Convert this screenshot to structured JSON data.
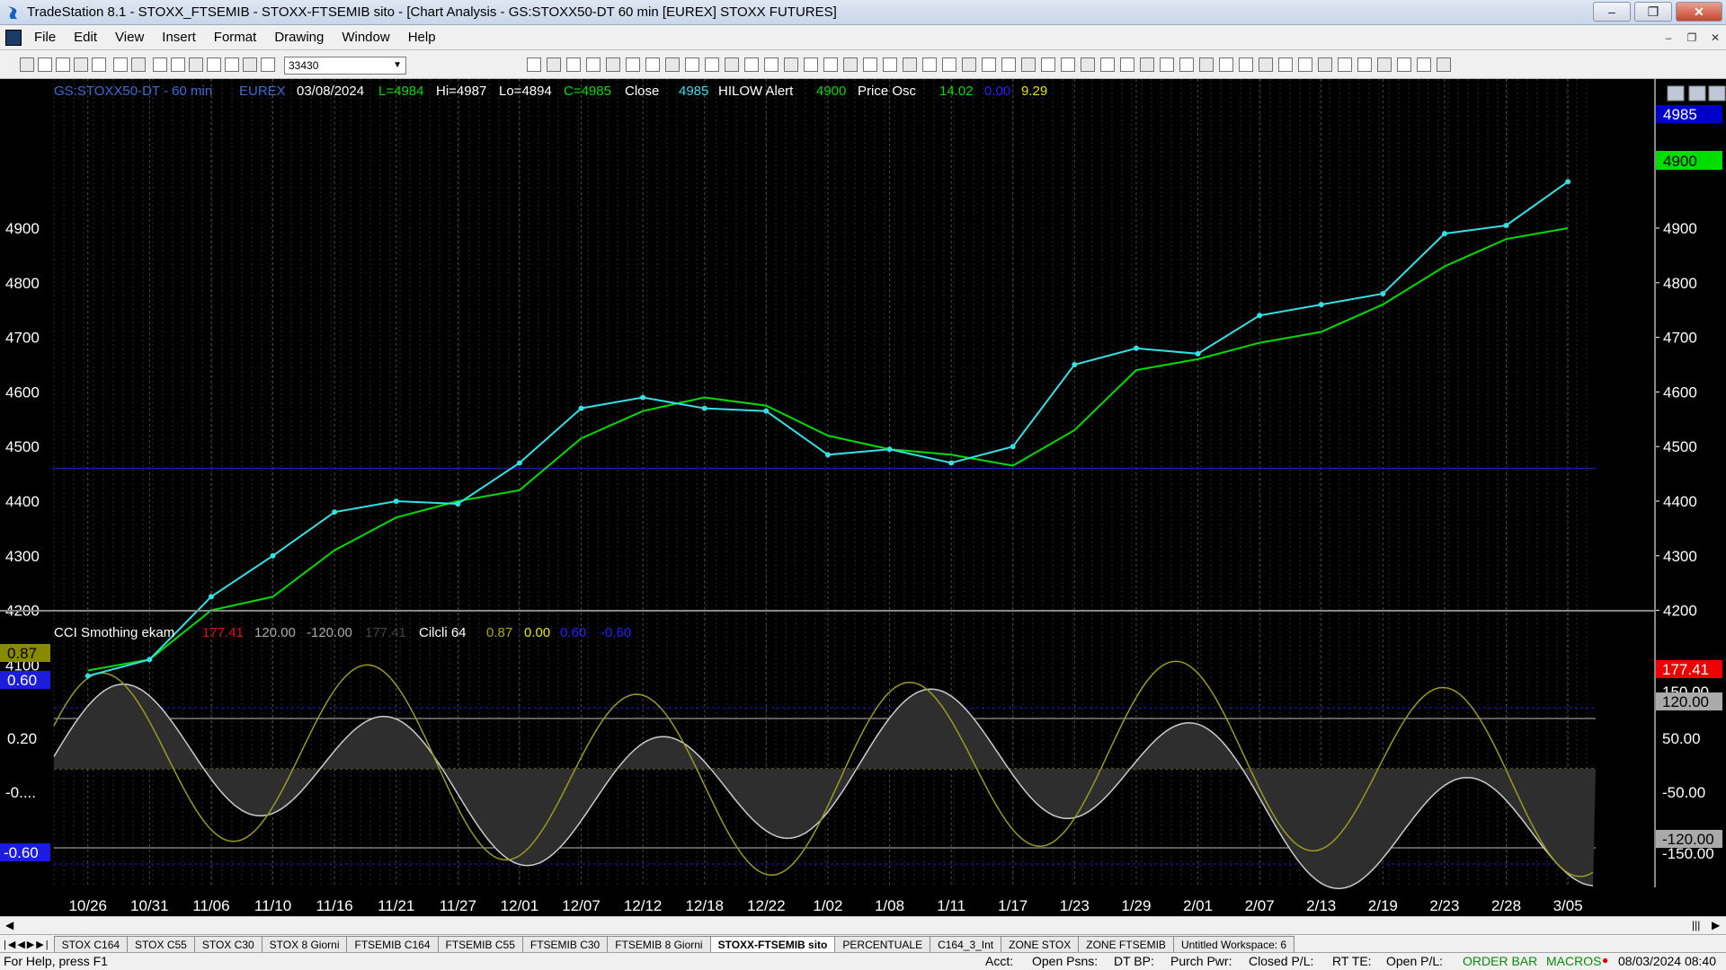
{
  "window": {
    "title": "TradeStation 8.1 - STOXX_FTSEMIB - STOXX-FTSEMIB sito - [Chart Analysis - GS:STOXX50-DT  60 min  [EUREX] STOXX FUTURES]",
    "minimize": "–",
    "restore": "❐",
    "close": "✕"
  },
  "menu": [
    "File",
    "Edit",
    "View",
    "Insert",
    "Format",
    "Drawing",
    "Window",
    "Help"
  ],
  "toolbar": {
    "symbol_value": "33430"
  },
  "chart_header": {
    "symbol": "GS:STOXX50-DT - 60 min",
    "exchange": "EUREX",
    "date": "03/08/2024",
    "last": "L=4984",
    "hi": "Hi=4987",
    "lo": "Lo=4894",
    "close_val": "C=4985",
    "close_label": "Close",
    "close_price": "4985",
    "ind1": "HILOW Alert",
    "ind1_val": "4900",
    "ind2": "Price Osc",
    "ind2_v1": "14.02",
    "ind2_v2": "0.00",
    "ind2_v3": "9.29"
  },
  "sub_header": {
    "ind1": "CCI Smothing ekam",
    "v1": "177.41",
    "v2": "120.00",
    "v3": "-120.00",
    "v4": "177.41",
    "ind2": "Cilcli 64",
    "c1": "0.87",
    "c2": "0.00",
    "c3": "0.60",
    "c4": "-0.60"
  },
  "price_axis": {
    "ticks": [
      "4900",
      "4800",
      "4700",
      "4600",
      "4500",
      "4400",
      "4300",
      "4200",
      "4100"
    ],
    "last_badge": "4985",
    "hilow_badge": "4900"
  },
  "osc_axis": {
    "right_ticks": [
      "150.00",
      "120.00",
      "50.00",
      "-50.00",
      "-120.00",
      "-150.00"
    ],
    "right_badge": "177.41",
    "left_ticks": [
      "0.20",
      "-0...."
    ],
    "left_badge_top": "0.87",
    "left_badge_mid": "0.60",
    "left_badge_bot": "-0.60"
  },
  "chart_data": {
    "type": "line",
    "x": [
      "10/26",
      "10/31",
      "11/06",
      "11/10",
      "11/16",
      "11/21",
      "11/27",
      "12/01",
      "12/07",
      "12/12",
      "12/18",
      "12/22",
      "1/02",
      "1/08",
      "1/11",
      "1/17",
      "1/23",
      "1/29",
      "2/01",
      "2/07",
      "2/13",
      "2/19",
      "2/23",
      "2/28",
      "3/05"
    ],
    "ylim": [
      4050,
      5000
    ],
    "hline": 4460,
    "series": [
      {
        "name": "Close",
        "color": "#33e0e6",
        "values": [
          4080,
          4110,
          4225,
          4300,
          4380,
          4400,
          4395,
          4470,
          4570,
          4590,
          4570,
          4565,
          4485,
          4495,
          4470,
          4500,
          4650,
          4680,
          4670,
          4740,
          4760,
          4780,
          4890,
          4905,
          4985
        ]
      },
      {
        "name": "HILOW Alert",
        "color": "#00dd00",
        "values": [
          4090,
          4110,
          4200,
          4225,
          4310,
          4370,
          4400,
          4420,
          4515,
          4565,
          4590,
          4575,
          4520,
          4495,
          4485,
          4465,
          4530,
          4640,
          4660,
          4690,
          4710,
          4760,
          4830,
          4880,
          4900
        ]
      }
    ]
  },
  "tabs": [
    "STOX C164",
    "STOX C55",
    "STOX  C30",
    "STOX  8 Giorni",
    "FTSEMIB C164",
    "FTSEMIB C55",
    "FTSEMIB C30",
    "FTSEMIB  8 Giorni",
    "STOXX-FTSEMIB sito",
    "PERCENTUALE",
    "C164_3_Int",
    "ZONE STOX",
    "ZONE FTSEMIB",
    "Untitled Workspace:  6"
  ],
  "active_tab": "STOXX-FTSEMIB sito",
  "status": {
    "help": "For Help, press F1",
    "acct": "Acct:",
    "open_psns": "Open Psns:",
    "dt_bp": "DT BP:",
    "purch_pwr": "Purch Pwr:",
    "closed_pl": "Closed P/L:",
    "rt_te": "RT TE:",
    "open_pl": "Open P/L:",
    "order_bar": "ORDER BAR",
    "macros": "MACROS",
    "datetime": "08/03/2024 08:40"
  },
  "colors": {
    "price": "#33e0e6",
    "hilow": "#00dd00",
    "osc_yellow": "#e6e600",
    "osc_green": "#22aa22",
    "osc_red": "#dd1111",
    "hline": "#1a1aaa"
  }
}
